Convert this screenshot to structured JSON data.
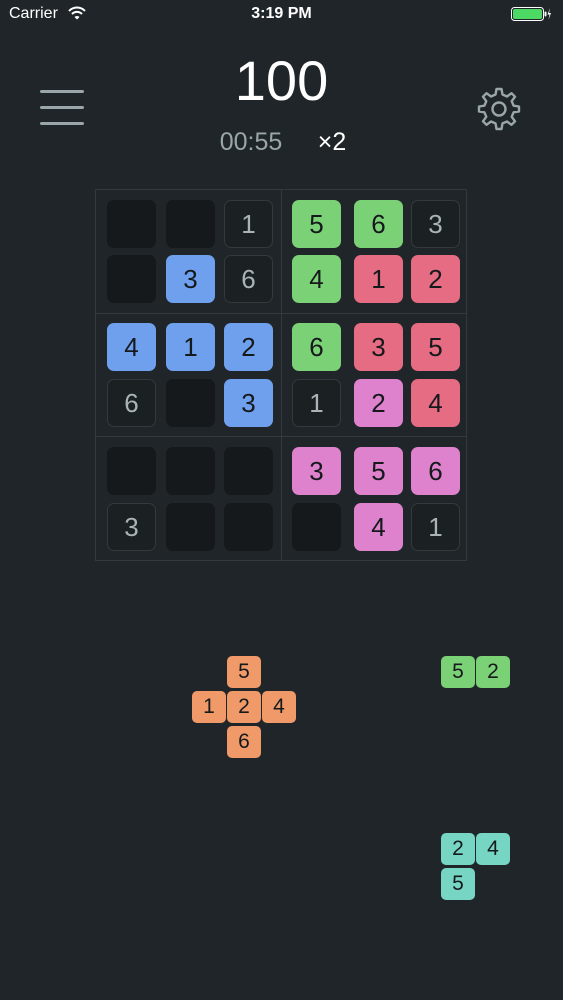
{
  "status_bar": {
    "carrier": "Carrier",
    "time": "3:19 PM"
  },
  "header": {
    "score": "100",
    "timer": "00:55",
    "multiplier": "×2",
    "menu_icon": "hamburger-menu-icon",
    "settings_icon": "gear-icon"
  },
  "colors": {
    "background": "#1f2528",
    "blue": "#6fa0ee",
    "green": "#7bd176",
    "red": "#e56c82",
    "pink": "#de82ce",
    "orange": "#ef9a68",
    "teal": "#76d6c3"
  },
  "board": {
    "rows": [
      [
        {
          "v": "",
          "s": "empty"
        },
        {
          "v": "",
          "s": "empty"
        },
        {
          "v": "1",
          "s": "fixed"
        },
        {
          "v": "5",
          "s": "green"
        },
        {
          "v": "6",
          "s": "green"
        },
        {
          "v": "3",
          "s": "fixed"
        }
      ],
      [
        {
          "v": "",
          "s": "empty"
        },
        {
          "v": "3",
          "s": "blue"
        },
        {
          "v": "6",
          "s": "fixed"
        },
        {
          "v": "4",
          "s": "green"
        },
        {
          "v": "1",
          "s": "red"
        },
        {
          "v": "2",
          "s": "red"
        }
      ],
      [
        {
          "v": "4",
          "s": "blue"
        },
        {
          "v": "1",
          "s": "blue"
        },
        {
          "v": "2",
          "s": "blue"
        },
        {
          "v": "6",
          "s": "green"
        },
        {
          "v": "3",
          "s": "red"
        },
        {
          "v": "5",
          "s": "red"
        }
      ],
      [
        {
          "v": "6",
          "s": "fixed"
        },
        {
          "v": "",
          "s": "empty"
        },
        {
          "v": "3",
          "s": "blue"
        },
        {
          "v": "1",
          "s": "fixed"
        },
        {
          "v": "2",
          "s": "pink"
        },
        {
          "v": "4",
          "s": "red"
        }
      ],
      [
        {
          "v": "",
          "s": "empty"
        },
        {
          "v": "",
          "s": "empty"
        },
        {
          "v": "",
          "s": "empty"
        },
        {
          "v": "3",
          "s": "pink"
        },
        {
          "v": "5",
          "s": "pink"
        },
        {
          "v": "6",
          "s": "pink"
        }
      ],
      [
        {
          "v": "3",
          "s": "fixed"
        },
        {
          "v": "",
          "s": "empty"
        },
        {
          "v": "",
          "s": "empty"
        },
        {
          "v": "",
          "s": "empty"
        },
        {
          "v": "4",
          "s": "pink"
        },
        {
          "v": "1",
          "s": "fixed"
        }
      ]
    ]
  },
  "pieces": [
    {
      "color": "orange",
      "tiles": [
        {
          "v": "5",
          "c": 1,
          "r": 0
        },
        {
          "v": "1",
          "c": 0,
          "r": 1
        },
        {
          "v": "2",
          "c": 1,
          "r": 1
        },
        {
          "v": "4",
          "c": 2,
          "r": 1
        },
        {
          "v": "6",
          "c": 1,
          "r": 2
        }
      ]
    },
    {
      "color": "green",
      "tiles": [
        {
          "v": "5",
          "c": 0,
          "r": 0
        },
        {
          "v": "2",
          "c": 1,
          "r": 0
        }
      ]
    },
    {
      "color": "teal",
      "tiles": [
        {
          "v": "2",
          "c": 0,
          "r": 0
        },
        {
          "v": "4",
          "c": 1,
          "r": 0
        },
        {
          "v": "5",
          "c": 0,
          "r": 1
        }
      ]
    }
  ]
}
